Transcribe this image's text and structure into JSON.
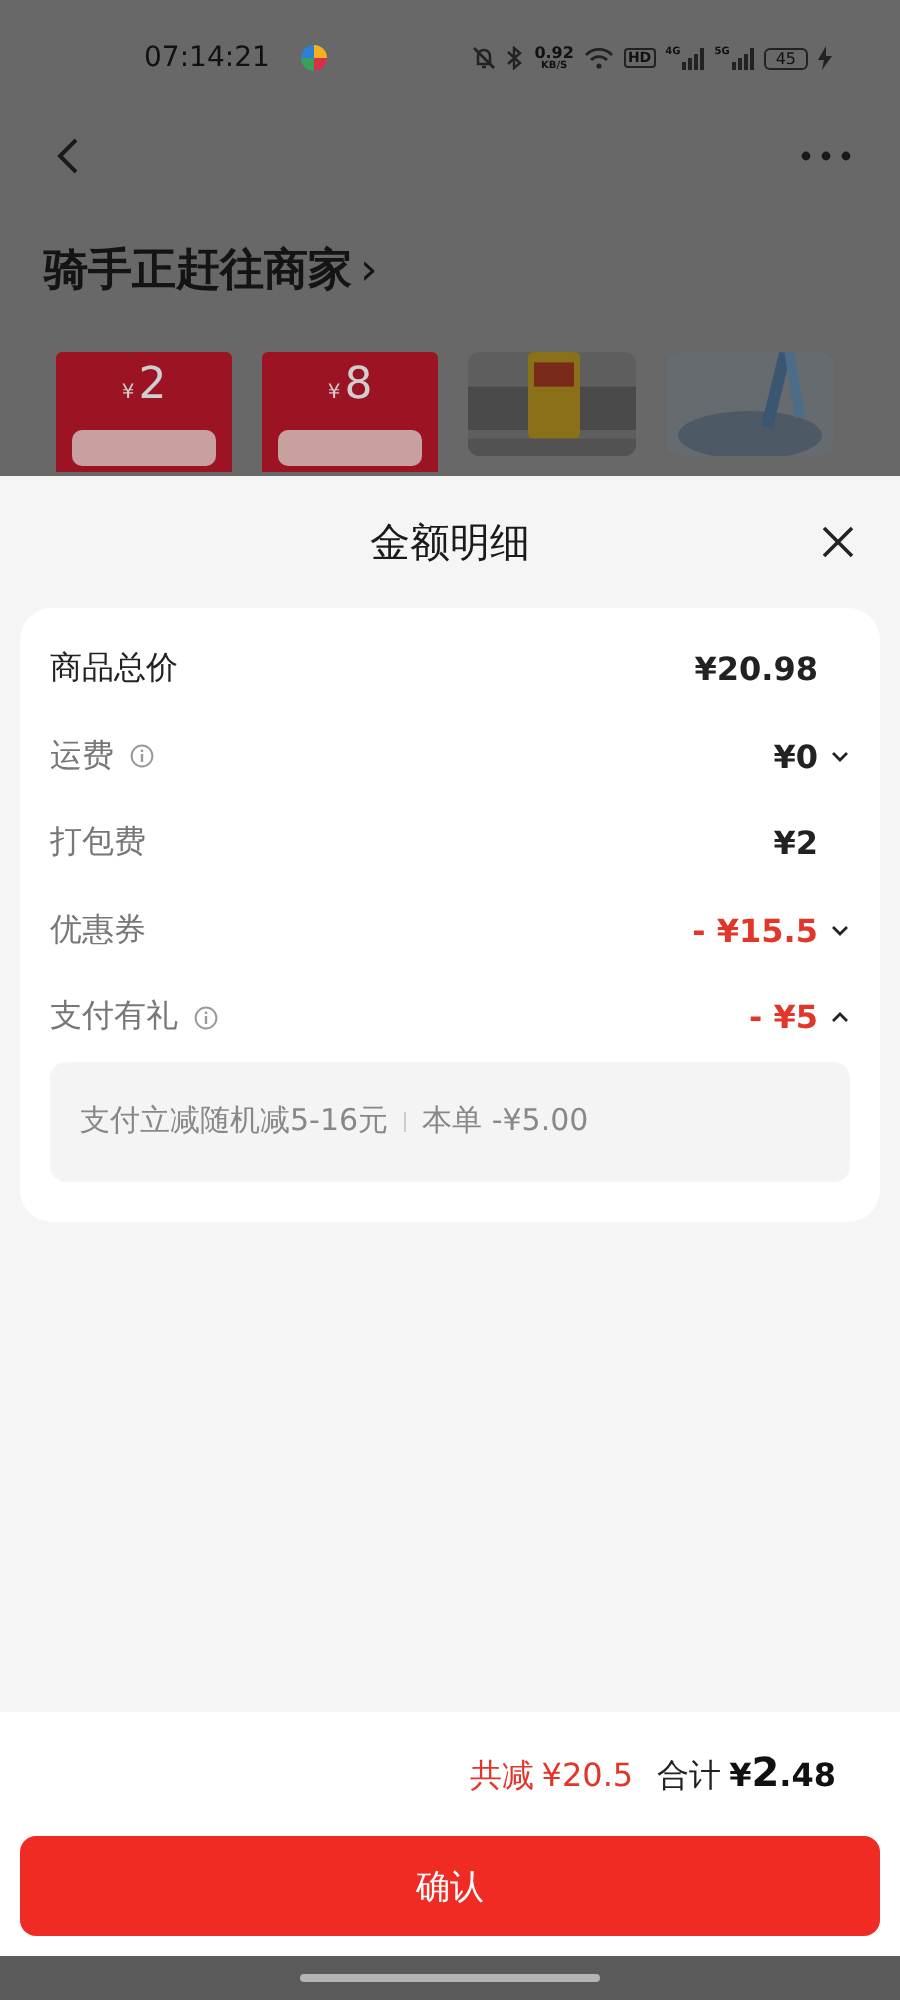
{
  "status_bar": {
    "time": "07:14:21",
    "net_speed": "0.92",
    "net_speed_unit": "KB/S",
    "hd": "HD",
    "signal_1": "4G",
    "signal_2": "5G",
    "battery": "45"
  },
  "header": {
    "title": "骑手正赶往商家",
    "chevron": "›"
  },
  "promo_cards": [
    {
      "kind": "coupon",
      "currency": "¥",
      "amount": "2"
    },
    {
      "kind": "coupon",
      "currency": "¥",
      "amount": "8"
    },
    {
      "kind": "picture"
    },
    {
      "kind": "picture"
    }
  ],
  "sheet": {
    "title": "金额明细",
    "rows": [
      {
        "label": "商品总价",
        "value": "¥20.98",
        "emphasis": true,
        "info": false,
        "discount": false,
        "expandable": false
      },
      {
        "label": "运费",
        "value": "¥0",
        "emphasis": false,
        "info": true,
        "discount": false,
        "expandable": true,
        "expanded": false
      },
      {
        "label": "打包费",
        "value": "¥2",
        "emphasis": false,
        "info": false,
        "discount": false,
        "expandable": false
      },
      {
        "label": "优惠券",
        "value": "- ¥15.5",
        "emphasis": false,
        "info": false,
        "discount": true,
        "expandable": true,
        "expanded": false
      },
      {
        "label": "支付有礼",
        "value": "- ¥5",
        "emphasis": false,
        "info": true,
        "discount": true,
        "expandable": true,
        "expanded": true,
        "detail": {
          "text": "支付立减随机减5-16元",
          "order": "本单 -¥5.00"
        }
      }
    ]
  },
  "footer": {
    "saving_label": "共减",
    "saving": "¥20.5",
    "total_label": "合计",
    "total_currency": "¥",
    "total_int": "2",
    "total_frac": ".48",
    "confirm": "确认"
  }
}
